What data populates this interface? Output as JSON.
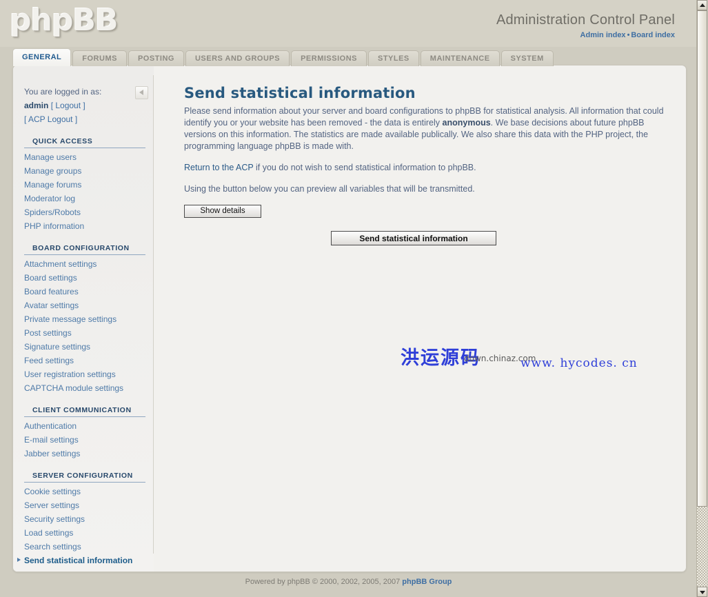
{
  "header": {
    "logo": "phpBB",
    "title": "Administration Control Panel",
    "links": [
      {
        "label": "Admin index"
      },
      {
        "label": "Board index"
      }
    ],
    "separator": "•"
  },
  "tabs": [
    {
      "label": "GENERAL",
      "active": true
    },
    {
      "label": "FORUMS",
      "active": false
    },
    {
      "label": "POSTING",
      "active": false
    },
    {
      "label": "USERS AND GROUPS",
      "active": false
    },
    {
      "label": "PERMISSIONS",
      "active": false
    },
    {
      "label": "STYLES",
      "active": false
    },
    {
      "label": "MAINTENANCE",
      "active": false
    },
    {
      "label": "SYSTEM",
      "active": false
    }
  ],
  "sidebar": {
    "logged_in_label": "You are logged in as:",
    "username": "admin",
    "logout_label": "[ Logout ]",
    "acp_logout_label": "[ ACP Logout ]",
    "collapse_icon": "triangle-left-icon",
    "sections": [
      {
        "heading": "QUICK ACCESS",
        "items": [
          {
            "label": "Manage users",
            "active": false
          },
          {
            "label": "Manage groups",
            "active": false
          },
          {
            "label": "Manage forums",
            "active": false
          },
          {
            "label": "Moderator log",
            "active": false
          },
          {
            "label": "Spiders/Robots",
            "active": false
          },
          {
            "label": "PHP information",
            "active": false
          }
        ]
      },
      {
        "heading": "BOARD CONFIGURATION",
        "items": [
          {
            "label": "Attachment settings",
            "active": false
          },
          {
            "label": "Board settings",
            "active": false
          },
          {
            "label": "Board features",
            "active": false
          },
          {
            "label": "Avatar settings",
            "active": false
          },
          {
            "label": "Private message settings",
            "active": false
          },
          {
            "label": "Post settings",
            "active": false
          },
          {
            "label": "Signature settings",
            "active": false
          },
          {
            "label": "Feed settings",
            "active": false
          },
          {
            "label": "User registration settings",
            "active": false
          },
          {
            "label": "CAPTCHA module settings",
            "active": false
          }
        ]
      },
      {
        "heading": "CLIENT COMMUNICATION",
        "items": [
          {
            "label": "Authentication",
            "active": false
          },
          {
            "label": "E-mail settings",
            "active": false
          },
          {
            "label": "Jabber settings",
            "active": false
          }
        ]
      },
      {
        "heading": "SERVER CONFIGURATION",
        "items": [
          {
            "label": "Cookie settings",
            "active": false
          },
          {
            "label": "Server settings",
            "active": false
          },
          {
            "label": "Security settings",
            "active": false
          },
          {
            "label": "Load settings",
            "active": false
          },
          {
            "label": "Search settings",
            "active": false
          },
          {
            "label": "Send statistical information",
            "active": true
          }
        ]
      }
    ]
  },
  "content": {
    "title": "Send statistical information",
    "paragraph1_part1": "Please send information about your server and board configurations to phpBB for statistical analysis. All information that could identify you or your website has been removed - the data is entirely ",
    "paragraph1_bold": "anonymous",
    "paragraph1_part2": ". We base decisions about future phpBB versions on this information. The statistics are made available publically. We also share this data with the PHP project, the programming language phpBB is made with.",
    "paragraph2_link": "Return to the ACP",
    "paragraph2_rest": " if you do not wish to send statistical information to phpBB.",
    "paragraph3": "Using the button below you can preview all variables that will be transmitted.",
    "show_details_label": "Show details",
    "send_stats_label": "Send statistical information"
  },
  "watermark": {
    "chinese": "洪运源码",
    "chinaz": "down.chinaz.com",
    "site": "www. hycodes. cn"
  },
  "footer": {
    "prefix": "Powered by phpBB © 2000, 2002, 2005, 2007 ",
    "group": "phpBB Group"
  },
  "scrollbar": {
    "up_icon": "triangle-up-icon",
    "down_icon": "triangle-down-icon"
  },
  "colors": {
    "page_bg": "#cfccc0",
    "panel_bg": "#f2f1ee",
    "accent_link": "#4e7aa8",
    "heading": "#28597f",
    "watermark_blue": "#2f3fd8"
  }
}
